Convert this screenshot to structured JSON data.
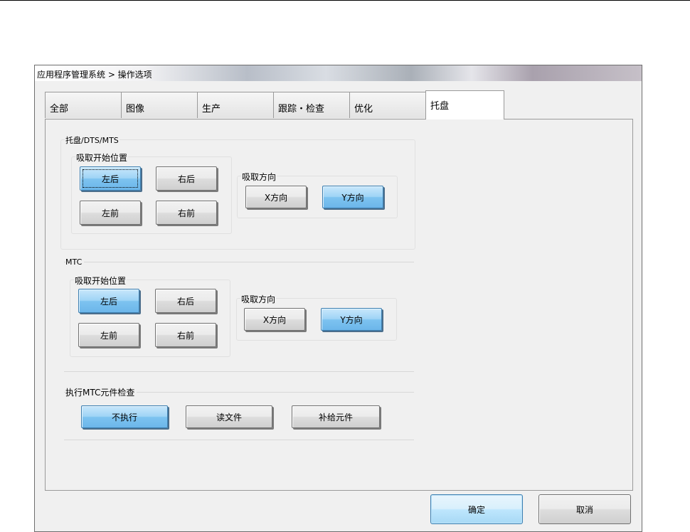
{
  "window": {
    "title": "应用程序管理系统 > 操作选项"
  },
  "tabs": [
    "全部",
    "图像",
    "生产",
    "跟踪・检查",
    "优化",
    "托盘"
  ],
  "active_tab": "托盘",
  "tray_section": {
    "title": "托盘/DTS/MTS",
    "pickup_start": {
      "label": "吸取开始位置",
      "buttons": [
        "左后",
        "右后",
        "左前",
        "右前"
      ],
      "selected": "左后"
    },
    "pickup_direction": {
      "label": "吸取方向",
      "buttons": [
        "X方向",
        "Y方向"
      ],
      "selected": "Y方向"
    }
  },
  "mtc_section": {
    "title": "MTC",
    "pickup_start": {
      "label": "吸取开始位置",
      "buttons": [
        "左后",
        "右后",
        "左前",
        "右前"
      ],
      "selected": "左后"
    },
    "pickup_direction": {
      "label": "吸取方向",
      "buttons": [
        "X方向",
        "Y方向"
      ],
      "selected": "Y方向"
    }
  },
  "mtc_check": {
    "title": "执行MTC元件检查",
    "buttons": [
      "不执行",
      "读文件",
      "补给元件"
    ],
    "selected": "不执行"
  },
  "footer": {
    "ok": "确定",
    "cancel": "取消"
  },
  "colors": {
    "selected": "#7dc3f0",
    "window_bg": "#f0f0f0"
  }
}
